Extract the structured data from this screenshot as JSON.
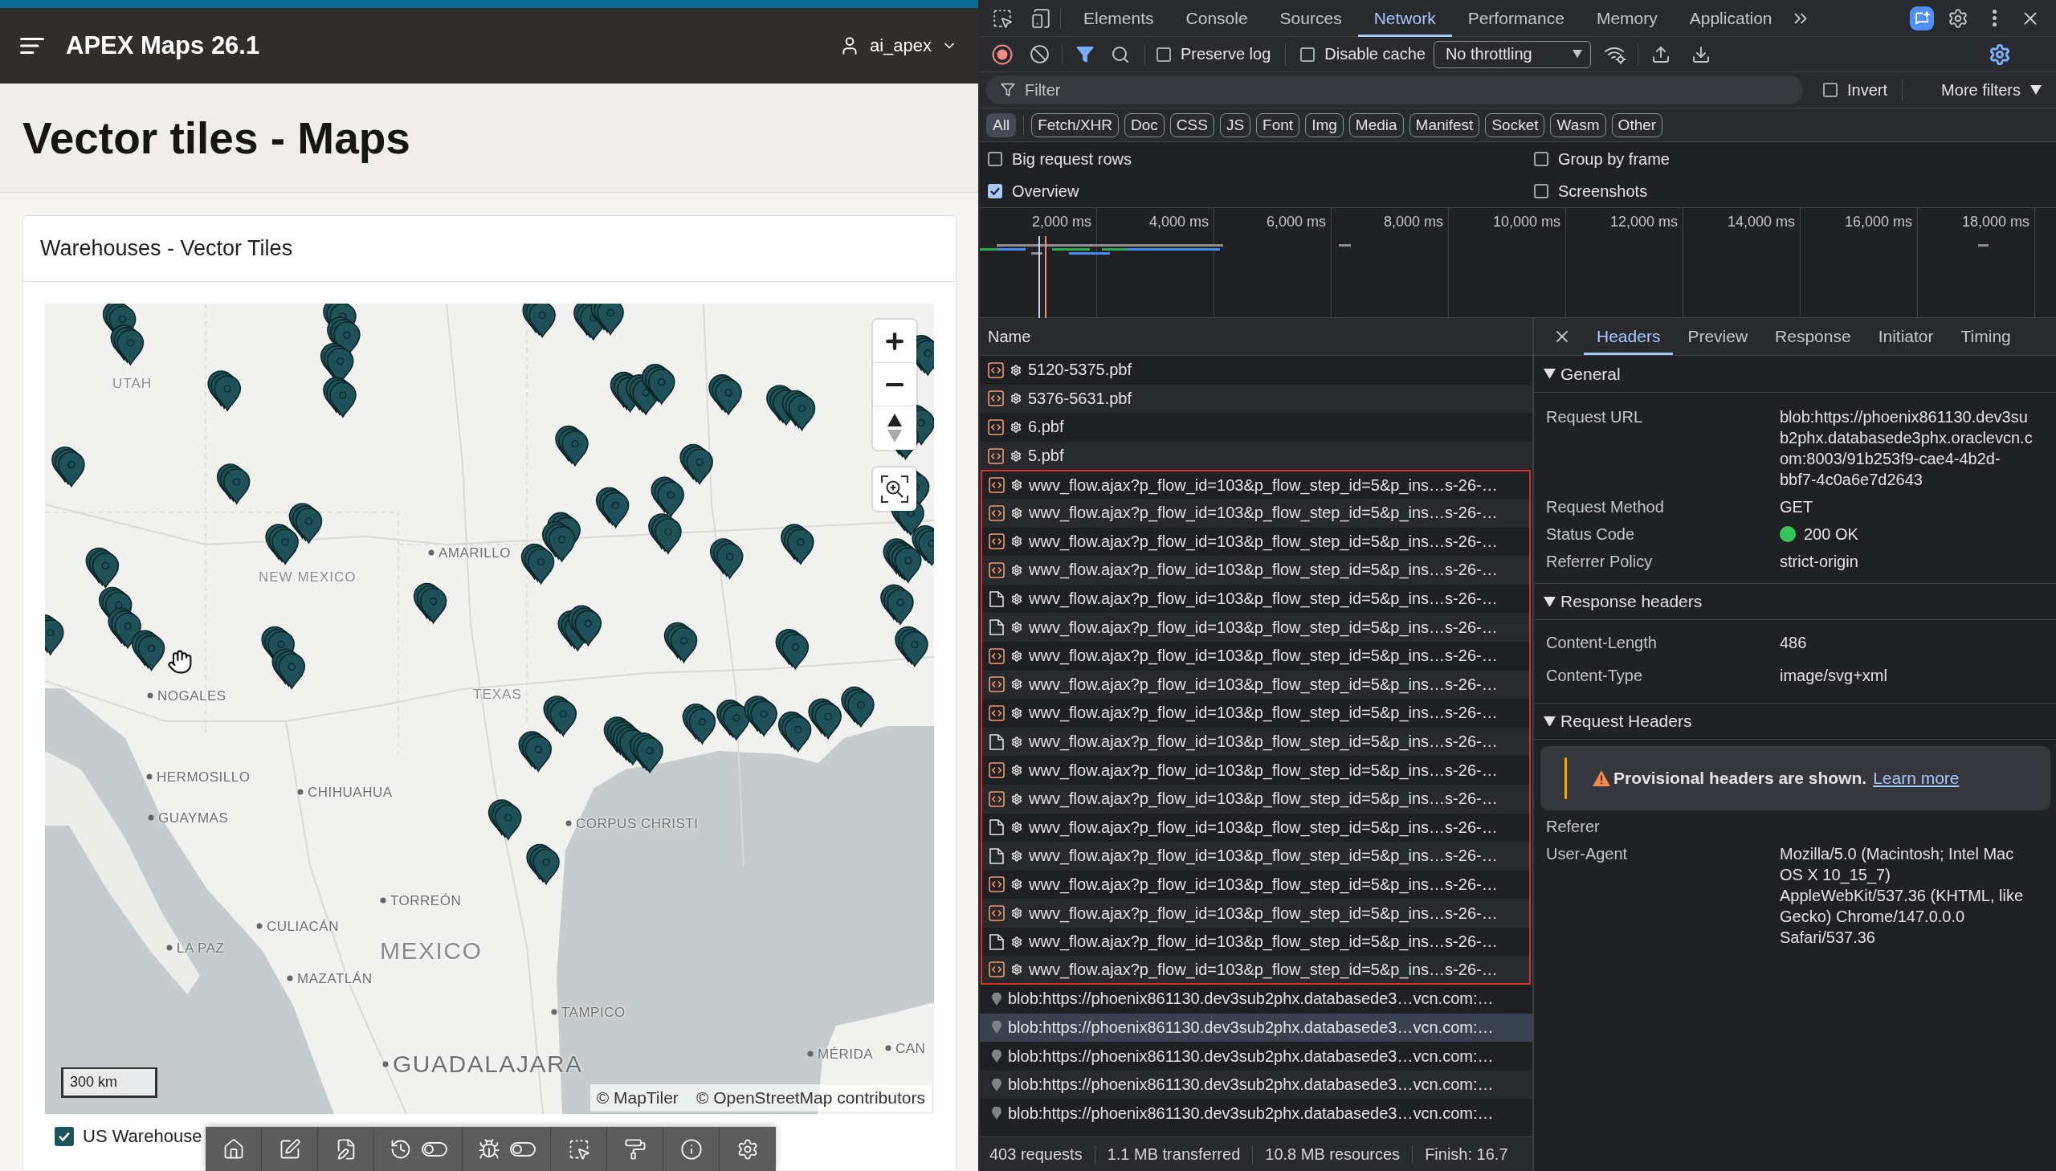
{
  "app_header": {
    "title": "APEX Maps 26.1",
    "user": "ai_apex"
  },
  "page": {
    "title": "Vector tiles - Maps"
  },
  "region": {
    "title": "Warehouses - Vector Tiles",
    "map": {
      "place_labels": [
        {
          "text": "UTAH",
          "kind": "region"
        },
        {
          "text": "NEW MEXICO",
          "kind": "region"
        },
        {
          "text": "AMARILLO",
          "kind": "city"
        },
        {
          "text": "TEXAS",
          "kind": "region"
        },
        {
          "text": "NOGALES",
          "kind": "city"
        },
        {
          "text": "HERMOSILLO",
          "kind": "city"
        },
        {
          "text": "CHIHUAHUA",
          "kind": "city"
        },
        {
          "text": "GUAYMAS",
          "kind": "city"
        },
        {
          "text": "CORPUS CHRISTI",
          "kind": "city"
        },
        {
          "text": "TORREÓN",
          "kind": "city"
        },
        {
          "text": "CULIACÁN",
          "kind": "city"
        },
        {
          "text": "LA PAZ",
          "kind": "city"
        },
        {
          "text": "MEXICO",
          "kind": "country"
        },
        {
          "text": "MAZATLÁN",
          "kind": "city"
        },
        {
          "text": "TAMPICO",
          "kind": "city"
        },
        {
          "text": "GUADALAJARA",
          "kind": "major_city"
        },
        {
          "text": "MÉRIDA",
          "kind": "city"
        },
        {
          "text": "CAN",
          "kind": "city"
        }
      ],
      "scale": "300 km",
      "attribution": [
        "© MapTiler",
        "© OpenStreetMap contributors"
      ]
    },
    "legend": [
      {
        "label": "US Warehouse",
        "checked": true
      }
    ]
  },
  "developer_toolbar": {
    "toggles": [
      {
        "on": false
      },
      {
        "on": false
      }
    ]
  },
  "devtools": {
    "tabs": [
      {
        "label": "Elements",
        "selected": false
      },
      {
        "label": "Console",
        "selected": false
      },
      {
        "label": "Sources",
        "selected": false
      },
      {
        "label": "Network",
        "selected": true
      },
      {
        "label": "Performance",
        "selected": false
      },
      {
        "label": "Memory",
        "selected": false
      },
      {
        "label": "Application",
        "selected": false
      }
    ],
    "network": {
      "recording": true,
      "preserve_log": {
        "label": "Preserve log",
        "checked": false
      },
      "disable_cache": {
        "label": "Disable cache",
        "checked": false
      },
      "throttling": "No throttling",
      "filter": {
        "placeholder": "Filter"
      },
      "invert": {
        "label": "Invert",
        "checked": false
      },
      "more_filters": "More filters",
      "type_filters": [
        {
          "label": "All",
          "selected": true
        },
        {
          "label": "Fetch/XHR",
          "selected": false
        },
        {
          "label": "Doc",
          "selected": false
        },
        {
          "label": "CSS",
          "selected": false
        },
        {
          "label": "JS",
          "selected": false
        },
        {
          "label": "Font",
          "selected": false
        },
        {
          "label": "Img",
          "selected": false
        },
        {
          "label": "Media",
          "selected": false
        },
        {
          "label": "Manifest",
          "selected": false
        },
        {
          "label": "Socket",
          "selected": false
        },
        {
          "label": "Wasm",
          "selected": false
        },
        {
          "label": "Other",
          "selected": false
        }
      ],
      "options": [
        {
          "label": "Big request rows",
          "checked": false
        },
        {
          "label": "Group by frame",
          "checked": false
        },
        {
          "label": "Overview",
          "checked": true
        },
        {
          "label": "Screenshots",
          "checked": false
        }
      ],
      "overview_ticks": [
        "2,000 ms",
        "4,000 ms",
        "6,000 ms",
        "8,000 ms",
        "10,000 ms",
        "12,000 ms",
        "14,000 ms",
        "16,000 ms",
        "18,000 ms"
      ],
      "requests": {
        "column": "Name",
        "rows": [
          {
            "name": "5120-5375.pbf",
            "kind": "script",
            "selected": false,
            "outlined": false
          },
          {
            "name": "5376-5631.pbf",
            "kind": "script",
            "selected": false,
            "outlined": false
          },
          {
            "name": "6.pbf",
            "kind": "script",
            "selected": false,
            "outlined": false
          },
          {
            "name": "5.pbf",
            "kind": "script",
            "selected": false,
            "outlined": false
          },
          {
            "name": "wwv_flow.ajax?p_flow_id=103&p_flow_step_id=5&p_ins…s-26-…",
            "kind": "script",
            "selected": false,
            "outlined": true
          },
          {
            "name": "wwv_flow.ajax?p_flow_id=103&p_flow_step_id=5&p_ins…s-26-…",
            "kind": "script",
            "selected": false,
            "outlined": true
          },
          {
            "name": "wwv_flow.ajax?p_flow_id=103&p_flow_step_id=5&p_ins…s-26-…",
            "kind": "script",
            "selected": false,
            "outlined": true
          },
          {
            "name": "wwv_flow.ajax?p_flow_id=103&p_flow_step_id=5&p_ins…s-26-…",
            "kind": "script",
            "selected": false,
            "outlined": true
          },
          {
            "name": "wwv_flow.ajax?p_flow_id=103&p_flow_step_id=5&p_ins…s-26-…",
            "kind": "document",
            "selected": false,
            "outlined": true
          },
          {
            "name": "wwv_flow.ajax?p_flow_id=103&p_flow_step_id=5&p_ins…s-26-…",
            "kind": "document",
            "selected": false,
            "outlined": true
          },
          {
            "name": "wwv_flow.ajax?p_flow_id=103&p_flow_step_id=5&p_ins…s-26-…",
            "kind": "script",
            "selected": false,
            "outlined": true
          },
          {
            "name": "wwv_flow.ajax?p_flow_id=103&p_flow_step_id=5&p_ins…s-26-…",
            "kind": "script",
            "selected": false,
            "outlined": true
          },
          {
            "name": "wwv_flow.ajax?p_flow_id=103&p_flow_step_id=5&p_ins…s-26-…",
            "kind": "script",
            "selected": false,
            "outlined": true
          },
          {
            "name": "wwv_flow.ajax?p_flow_id=103&p_flow_step_id=5&p_ins…s-26-…",
            "kind": "document",
            "selected": false,
            "outlined": true
          },
          {
            "name": "wwv_flow.ajax?p_flow_id=103&p_flow_step_id=5&p_ins…s-26-…",
            "kind": "script",
            "selected": false,
            "outlined": true
          },
          {
            "name": "wwv_flow.ajax?p_flow_id=103&p_flow_step_id=5&p_ins…s-26-…",
            "kind": "script",
            "selected": false,
            "outlined": true
          },
          {
            "name": "wwv_flow.ajax?p_flow_id=103&p_flow_step_id=5&p_ins…s-26-…",
            "kind": "document",
            "selected": false,
            "outlined": true
          },
          {
            "name": "wwv_flow.ajax?p_flow_id=103&p_flow_step_id=5&p_ins…s-26-…",
            "kind": "document",
            "selected": false,
            "outlined": true
          },
          {
            "name": "wwv_flow.ajax?p_flow_id=103&p_flow_step_id=5&p_ins…s-26-…",
            "kind": "script",
            "selected": false,
            "outlined": true
          },
          {
            "name": "wwv_flow.ajax?p_flow_id=103&p_flow_step_id=5&p_ins…s-26-…",
            "kind": "script",
            "selected": false,
            "outlined": true
          },
          {
            "name": "wwv_flow.ajax?p_flow_id=103&p_flow_step_id=5&p_ins…s-26-…",
            "kind": "document",
            "selected": false,
            "outlined": true
          },
          {
            "name": "wwv_flow.ajax?p_flow_id=103&p_flow_step_id=5&p_ins…s-26-…",
            "kind": "script",
            "selected": false,
            "outlined": true
          },
          {
            "name": "blob:https://phoenix861130.dev3sub2phx.databasede3…vcn.com:…",
            "kind": "blob",
            "selected": false,
            "outlined": false
          },
          {
            "name": "blob:https://phoenix861130.dev3sub2phx.databasede3…vcn.com:…",
            "kind": "blob",
            "selected": true,
            "outlined": false
          },
          {
            "name": "blob:https://phoenix861130.dev3sub2phx.databasede3…vcn.com:…",
            "kind": "blob",
            "selected": false,
            "outlined": false
          },
          {
            "name": "blob:https://phoenix861130.dev3sub2phx.databasede3…vcn.com:…",
            "kind": "blob",
            "selected": false,
            "outlined": false
          },
          {
            "name": "blob:https://phoenix861130.dev3sub2phx.databasede3…vcn.com:…",
            "kind": "blob",
            "selected": false,
            "outlined": false
          }
        ]
      },
      "details": {
        "tabs": [
          {
            "label": "Headers",
            "selected": true
          },
          {
            "label": "Preview",
            "selected": false
          },
          {
            "label": "Response",
            "selected": false
          },
          {
            "label": "Initiator",
            "selected": false
          },
          {
            "label": "Timing",
            "selected": false
          }
        ],
        "sections": [
          {
            "title": "General",
            "expanded": true,
            "rows": [
              {
                "name": "Request URL",
                "value": "blob:https://phoenix861130.dev3sub2phx.databasede3phx.oraclevcn.com:8003/91b253f9-cae4-4b2d-bbf7-4c0a6e7d2643",
                "kind": "text"
              },
              {
                "name": "Request Method",
                "value": "GET",
                "kind": "text"
              },
              {
                "name": "Status Code",
                "value": "200 OK",
                "kind": "status"
              },
              {
                "name": "Referrer Policy",
                "value": "strict-origin",
                "kind": "text"
              }
            ]
          },
          {
            "title": "Response headers",
            "expanded": true,
            "rows": [
              {
                "name": "Content-Length",
                "value": "486",
                "kind": "text"
              },
              {
                "name": "Content-Type",
                "value": "image/svg+xml",
                "kind": "text"
              }
            ]
          },
          {
            "title": "Request Headers",
            "expanded": true,
            "notice": {
              "text": "Provisional headers are shown.",
              "link": "Learn more"
            },
            "rows": [
              {
                "name": "Referer",
                "kind": "text"
              },
              {
                "name": "User-Agent",
                "value": "Mozilla/5.0 (Macintosh; Intel Mac OS X 10_15_7) AppleWebKit/537.36 (KHTML, like Gecko) Chrome/147.0.0.0 Safari/537.36",
                "kind": "text"
              }
            ]
          }
        ]
      },
      "status_bar": [
        "403 requests",
        "1.1 MB transferred",
        "10.8 MB resources",
        "Finish: 16.7"
      ]
    }
  }
}
